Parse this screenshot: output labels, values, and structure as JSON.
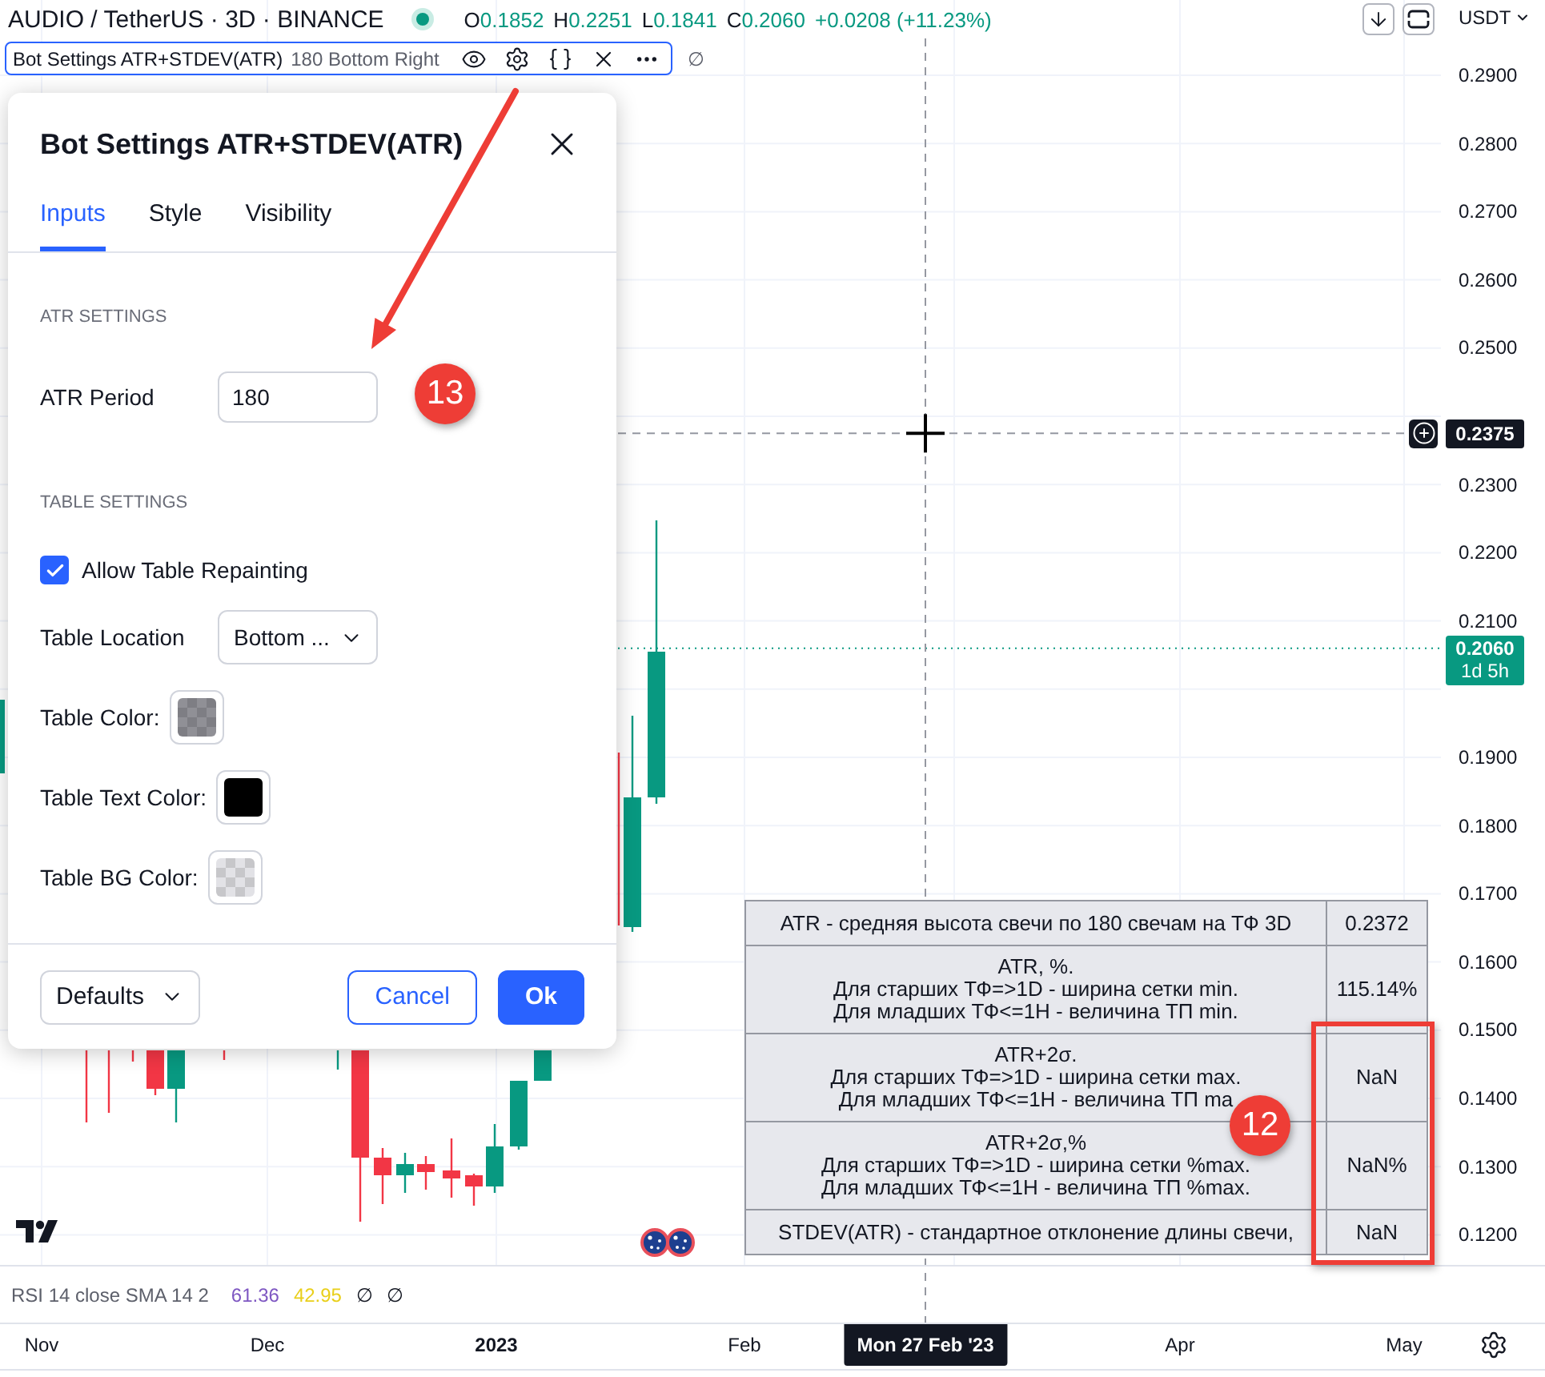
{
  "header": {
    "symbol": "AUDIO / TetherUS · 3D · BINANCE",
    "ohlc": [
      {
        "label": "O",
        "value": "0.1852"
      },
      {
        "label": "H",
        "value": "0.2251"
      },
      {
        "label": "L",
        "value": "0.1841"
      },
      {
        "label": "C",
        "value": "0.2060"
      }
    ],
    "change": "+0.0208 (+11.23%)"
  },
  "indicator_legend": {
    "title": "Bot Settings ATR+STDEV(ATR)",
    "params": "180 Bottom Right",
    "trailing": "∅"
  },
  "price_axis": {
    "currency": "USDT",
    "labels": [
      "0.2900",
      "0.2800",
      "0.2700",
      "0.2600",
      "0.2500",
      "0.2300",
      "0.2200",
      "0.2100",
      "0.1900",
      "0.1800",
      "0.1700",
      "0.1600",
      "0.1500",
      "0.1400",
      "0.1300",
      "0.1200"
    ],
    "crosshair_price": "0.2375",
    "last_price": "0.2060",
    "countdown": "1d 5h"
  },
  "dialog": {
    "title": "Bot Settings ATR+STDEV(ATR)",
    "tabs": [
      {
        "label": "Inputs",
        "selected": true
      },
      {
        "label": "Style",
        "selected": false
      },
      {
        "label": "Visibility",
        "selected": false
      }
    ],
    "fields": [
      {
        "kind": "section",
        "label": "ATR SETTINGS"
      },
      {
        "kind": "number",
        "label": "ATR Period",
        "value": "180"
      },
      {
        "kind": "section",
        "label": "TABLE SETTINGS"
      },
      {
        "kind": "checkbox",
        "label": "Allow Table Repainting",
        "checked": true
      },
      {
        "kind": "select",
        "label": "Table Location",
        "value": "Bottom ..."
      },
      {
        "kind": "color",
        "label": "Table Color:",
        "color": "#909096",
        "checkered": true
      },
      {
        "kind": "color",
        "label": "Table Text Color:",
        "color": "#000000",
        "checkered": false
      },
      {
        "kind": "color",
        "label": "Table BG Color:",
        "color": "#e2e2e6",
        "checkered": true
      }
    ],
    "footer": {
      "preset": "Defaults",
      "buttons": [
        {
          "label": "Cancel",
          "kind": "secondary"
        },
        {
          "label": "Ok",
          "kind": "primary"
        }
      ]
    }
  },
  "table": {
    "rows": [
      {
        "lines": [
          "ATR - средняя высота свечи по 180 свечам на ТФ 3D"
        ],
        "value": "0.2372"
      },
      {
        "lines": [
          "ATR, %.",
          "Для старших ТФ=>1D - ширина сетки min.",
          "Для младших ТФ<=1H - величина ТП min."
        ],
        "value": "115.14%"
      },
      {
        "lines": [
          "ATR+2σ.",
          "Для старших ТФ=>1D - ширина сетки max.",
          "Для младших ТФ<=1H - величина ТП ma"
        ],
        "value": "NaN"
      },
      {
        "lines": [
          "ATR+2σ,%",
          "Для старших ТФ=>1D - ширина сетки %max.",
          "Для младших ТФ<=1H - величина ТП %max."
        ],
        "value": "NaN%"
      },
      {
        "lines": [
          "STDEV(ATR) - стандартное отклонение длины свечи,"
        ],
        "value": "NaN"
      }
    ]
  },
  "rsi_legend": {
    "title": "RSI 14 close SMA 14 2",
    "values": [
      {
        "text": "61.36",
        "color": "#7e57c2"
      },
      {
        "text": "42.95",
        "color": "#e9cf1a"
      },
      {
        "text": "∅",
        "color": "#131722"
      },
      {
        "text": "∅",
        "color": "#131722"
      }
    ]
  },
  "time_axis": {
    "labels": [
      {
        "text": "Nov",
        "kind": "month"
      },
      {
        "text": "Dec",
        "kind": "month"
      },
      {
        "text": "2023",
        "kind": "year"
      },
      {
        "text": "Feb",
        "kind": "month"
      },
      {
        "text": "Mon 27 Feb '23",
        "kind": "crosshair"
      },
      {
        "text": "Apr",
        "kind": "month"
      },
      {
        "text": "May",
        "kind": "month"
      }
    ]
  },
  "annotations": {
    "badges": [
      "13",
      "12"
    ]
  }
}
